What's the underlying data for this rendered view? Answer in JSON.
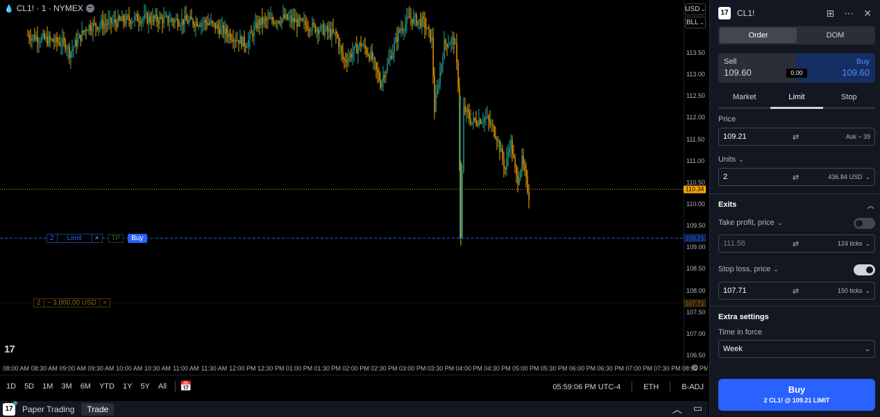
{
  "chart": {
    "symbol": "CL1! · 1 · NYMEX",
    "currency": "USD",
    "unit": "BLL",
    "price_ticks": [
      "113.50",
      "113.00",
      "112.50",
      "112.00",
      "111.50",
      "111.00",
      "110.50",
      "110.00",
      "109.50",
      "109.00",
      "108.50",
      "108.00",
      "107.50",
      "107.00",
      "106.50"
    ],
    "price_tick_values": [
      113.5,
      113.0,
      112.5,
      112.0,
      111.5,
      111.0,
      110.5,
      110.0,
      109.5,
      109.0,
      108.5,
      108.0,
      107.5,
      107.0,
      106.5
    ],
    "time_ticks": [
      "08:00 AM",
      "08:30 AM",
      "09:00 AM",
      "09:30 AM",
      "10:00 AM",
      "10:30 AM",
      "11:00 AM",
      "11:30 AM",
      "12:00 PM",
      "12:30 PM",
      "01:00 PM",
      "01:30 PM",
      "02:00 PM",
      "02:30 PM",
      "03:00 PM",
      "03:30 PM",
      "04:00 PM",
      "04:30 PM",
      "05:00 PM",
      "05:30 PM",
      "06:00 PM",
      "06:30 PM",
      "07:00 PM",
      "07:30 PM",
      "08:00 PM",
      "08:30 PM"
    ],
    "last_price": "110.34",
    "order_price": "109.21",
    "stop_price": "107.71",
    "limit_order": {
      "qty": "2",
      "type": "Limit",
      "close": "×",
      "tp": "TP",
      "side": "Buy"
    },
    "stop_order": {
      "qty": "2",
      "pnl": "− 3,000.00 USD",
      "close": "×"
    },
    "colors": {
      "up": "#26a69a",
      "down": "#f7a600",
      "buy": "#2962ff",
      "last": "#f7a600"
    }
  },
  "range_bar": {
    "ranges": [
      "1D",
      "5D",
      "1M",
      "3M",
      "6M",
      "YTD",
      "1Y",
      "5Y",
      "All"
    ],
    "clock": "05:59:06 PM UTC-4",
    "session": "ETH",
    "adjust": "B-ADJ"
  },
  "panel_bar": {
    "logo": "17",
    "tab_paper": "Paper Trading",
    "tab_trade": "Trade"
  },
  "order_panel": {
    "logo": "17",
    "symbol": "CL1!",
    "mode_tabs": [
      "Order",
      "DOM"
    ],
    "sell_label": "Sell",
    "sell_price": "109.60",
    "buy_label": "Buy",
    "buy_price": "109.60",
    "spread": "0.00",
    "type_tabs": [
      "Market",
      "Limit",
      "Stop"
    ],
    "price_label": "Price",
    "price_value": "109.21",
    "price_aux": "Ask − 39",
    "units_label": "Units",
    "units_value": "2",
    "units_aux": "436.84 USD",
    "exits_label": "Exits",
    "tp_label": "Take profit, price",
    "tp_value": "111.56",
    "tp_aux": "124 ticks",
    "tp_enabled": false,
    "sl_label": "Stop loss, price",
    "sl_value": "107.71",
    "sl_aux": "150 ticks",
    "sl_enabled": true,
    "extra_label": "Extra settings",
    "tif_label": "Time in force",
    "tif_value": "Week",
    "buy_button": "Buy",
    "buy_summary": "2 CL1! @ 109.21 LIMIT"
  }
}
